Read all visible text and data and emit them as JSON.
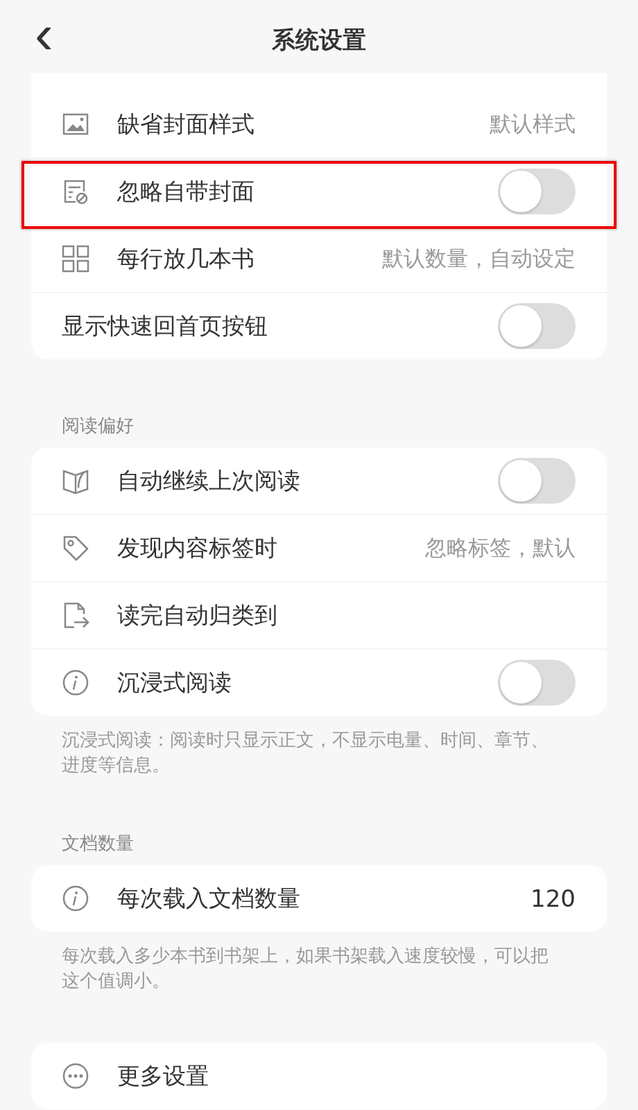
{
  "header": {
    "back": "‹",
    "title": "系统设置"
  },
  "sections": [
    {
      "items": [
        {
          "kind": "value",
          "label": "缺省封面样式",
          "value": "默认样式",
          "highlighted": false
        },
        {
          "kind": "toggle",
          "label": "忽略自带封面",
          "on": false,
          "highlighted": true
        },
        {
          "kind": "value",
          "label": "每行放几本书",
          "value": "默认数量，自动设定",
          "highlighted": false
        },
        {
          "kind": "toggle",
          "label": "显示快速回首页按钮",
          "on": false,
          "highlighted": false
        }
      ]
    },
    {
      "title": "阅读偏好",
      "items": [
        {
          "kind": "toggle",
          "label": "自动继续上次阅读",
          "on": false,
          "highlighted": false
        },
        {
          "kind": "value",
          "label": "发现内容标签时",
          "value": "忽略标签，默认",
          "highlighted": false
        },
        {
          "kind": "nav",
          "label": "读完自动归类到",
          "highlighted": false
        },
        {
          "kind": "toggle",
          "label": "沉浸式阅读",
          "on": false,
          "highlighted": false
        }
      ],
      "note": "沉浸式阅读：阅读时只显示正文，不显示电量、时间、章节、进度等信息。"
    },
    {
      "title": "文档数量",
      "items": [
        {
          "kind": "number",
          "label": "每次载入文档数量",
          "value": "120",
          "highlighted": false
        }
      ],
      "note": "每次载入多少本书到书架上，如果书架载入速度较慢，可以把这个值调小。"
    },
    {
      "items": [
        {
          "kind": "nav",
          "label": "更多设置",
          "highlighted": false
        }
      ]
    }
  ]
}
